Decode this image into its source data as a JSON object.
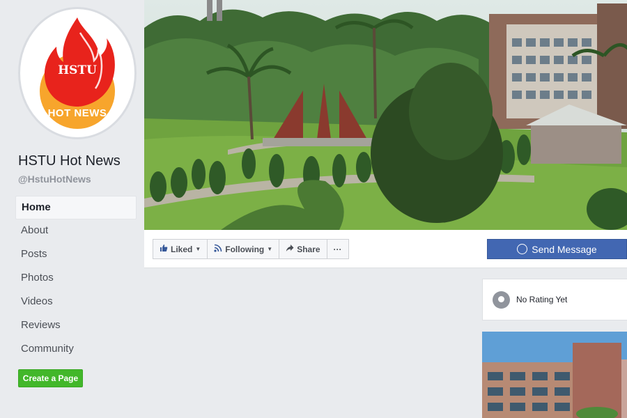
{
  "page": {
    "logo_top_text": "HSTU",
    "logo_bottom_text": "HOT NEWS",
    "name": "HSTU Hot News",
    "handle": "@HstuHotNews"
  },
  "nav": {
    "items": [
      {
        "label": "Home",
        "active": true
      },
      {
        "label": "About"
      },
      {
        "label": "Posts"
      },
      {
        "label": "Photos"
      },
      {
        "label": "Videos"
      },
      {
        "label": "Reviews"
      },
      {
        "label": "Community"
      }
    ],
    "create_page_label": "Create a Page"
  },
  "actions": {
    "liked_label": "Liked",
    "following_label": "Following",
    "share_label": "Share",
    "more_label": "···",
    "send_message_label": "Send Message"
  },
  "rating": {
    "text": "No Rating Yet"
  },
  "colors": {
    "brand_blue": "#4267b2",
    "create_green": "#42b72a",
    "flame_red": "#e8231c",
    "flame_orange": "#f7a52c"
  },
  "icons": {
    "liked": "thumbs-up-icon",
    "following": "rss-icon",
    "share": "share-arrow-icon",
    "messenger": "messenger-icon",
    "rating": "rating-bubble-icon"
  }
}
